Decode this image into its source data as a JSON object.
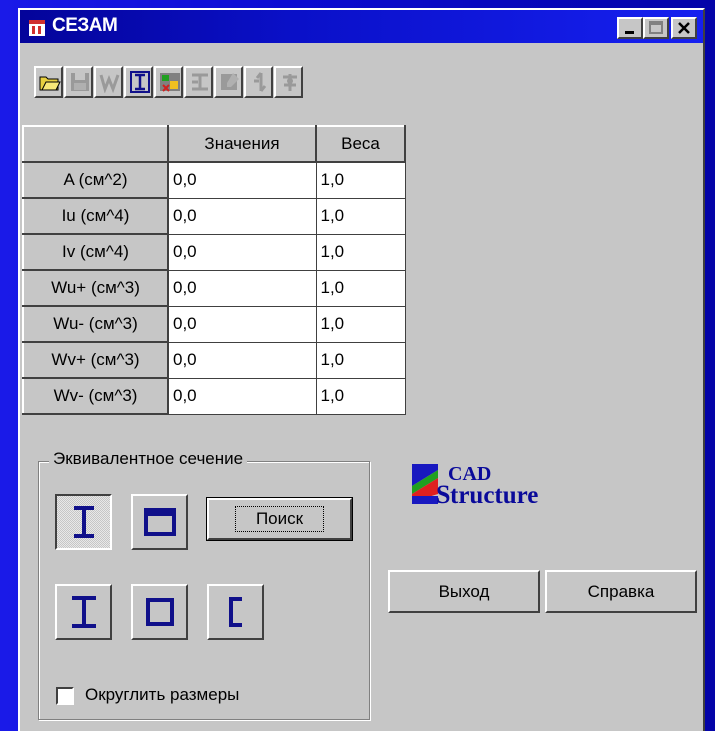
{
  "window": {
    "title": "СЕЗАМ",
    "controls": [
      "minimize-icon",
      "maximize-icon",
      "close-icon"
    ]
  },
  "toolbar": {
    "buttons": [
      {
        "name": "open-folder-icon",
        "enabled": true
      },
      {
        "name": "save-disk-icon",
        "enabled": false
      },
      {
        "name": "weight-w-icon",
        "enabled": false
      },
      {
        "name": "i-beam-frame-icon",
        "enabled": true
      },
      {
        "name": "profile-library-icon",
        "enabled": true
      },
      {
        "name": "section-shape-icon",
        "enabled": false
      },
      {
        "name": "table-edit-icon",
        "enabled": false
      },
      {
        "name": "arrows-icon",
        "enabled": false
      },
      {
        "name": "tool-icon",
        "enabled": false
      }
    ]
  },
  "grid": {
    "columns": [
      "",
      "Значения",
      "Веса"
    ],
    "rows": [
      {
        "label": "A  (см^2)",
        "value": "0,0",
        "weight": "1,0"
      },
      {
        "label": "Iu  (см^4)",
        "value": "0,0",
        "weight": "1,0"
      },
      {
        "label": "Iv  (см^4)",
        "value": "0,0",
        "weight": "1,0"
      },
      {
        "label": "Wu+ (см^3)",
        "value": "0,0",
        "weight": "1,0"
      },
      {
        "label": "Wu- (см^3)",
        "value": "0,0",
        "weight": "1,0"
      },
      {
        "label": "Wv+ (см^3)",
        "value": "0,0",
        "weight": "1,0"
      },
      {
        "label": "Wv- (см^3)",
        "value": "0,0",
        "weight": "1,0"
      }
    ]
  },
  "equivalent_section": {
    "label": "Эквивалентное сечение",
    "search_label": "Поиск",
    "round_sizes_label": "Округлить размеры",
    "round_sizes_checked": false,
    "shapes": [
      "i-beam-wide-icon",
      "box-section-icon",
      "i-beam-icon",
      "square-tube-icon",
      "channel-icon"
    ]
  },
  "actions": {
    "exit_label": "Выход",
    "help_label": "Справка"
  },
  "logo": {
    "line1": "CAD",
    "line2": "tructure",
    "initial": "S"
  },
  "colors": {
    "title_bar": "#0a10c8",
    "icon_blue": "#10108a",
    "face": "#c6c6c6"
  }
}
